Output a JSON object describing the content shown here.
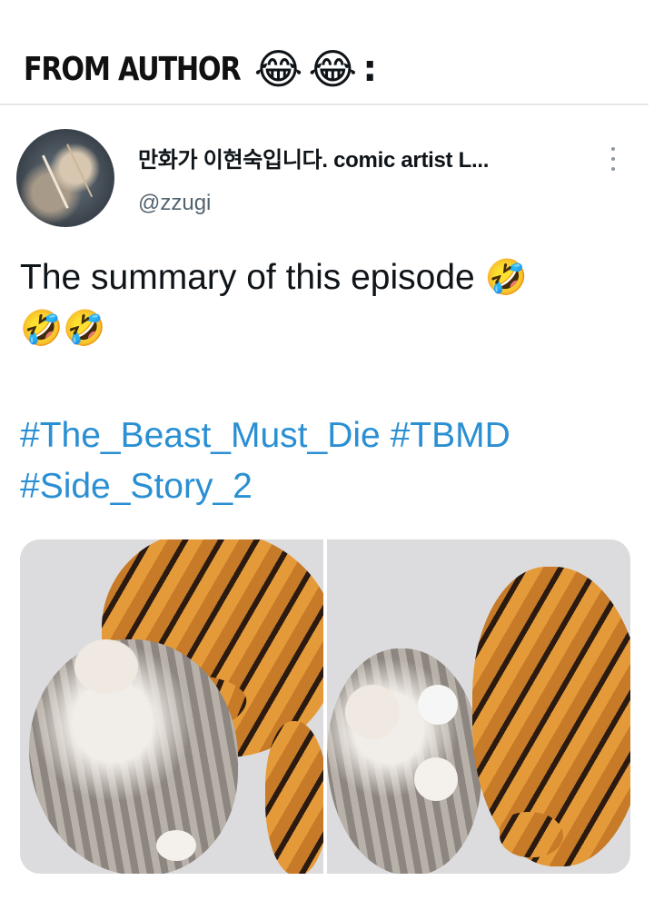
{
  "caption": {
    "text": "FROM AUTHOR",
    "emojis": [
      "😂",
      "😂"
    ],
    "suffix": ":"
  },
  "tweet": {
    "display_name": "만화가 이현숙입니다. comic artist L...",
    "handle": "@zzugi",
    "text": "The summary of this episode",
    "text_emojis": [
      "🤣",
      "🤣",
      "🤣"
    ],
    "hashtags": [
      "#The_Beast_Must_Die",
      "#TBMD",
      "#Side_Story_2"
    ],
    "more_icon": "more-vertical-icon",
    "media": {
      "panels": [
        "tiger pawing cat",
        "tiger swatting cat"
      ]
    }
  },
  "colors": {
    "hashtag": "#2a8fd3",
    "handle": "#536471",
    "divider": "#e6e8ea"
  }
}
